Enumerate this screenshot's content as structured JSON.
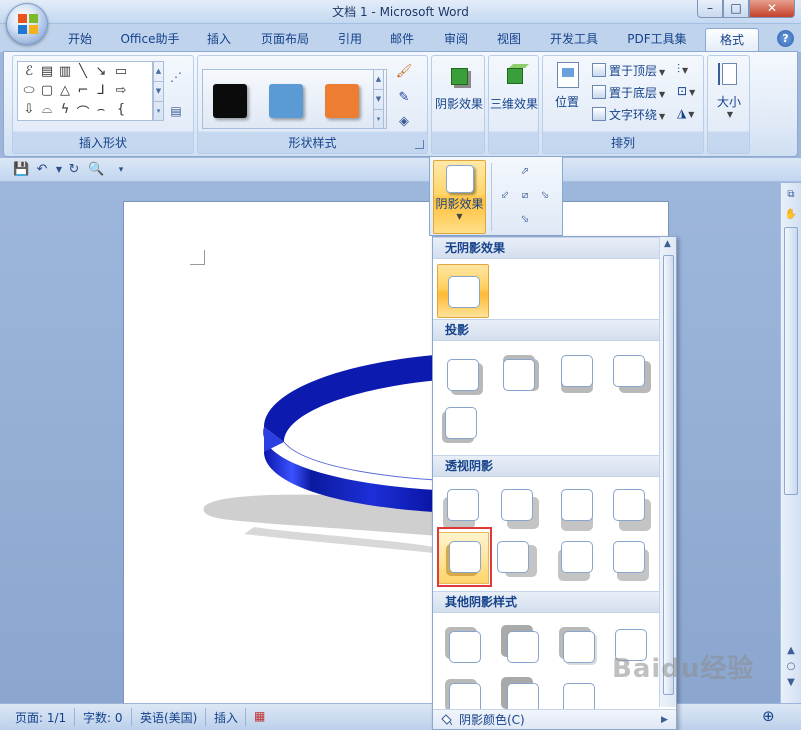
{
  "window": {
    "title": "文档 1 - Microsoft Word"
  },
  "tabs": [
    "开始",
    "Office助手",
    "插入",
    "页面布局",
    "引用",
    "邮件",
    "审阅",
    "视图",
    "开发工具",
    "PDF工具集",
    "格式"
  ],
  "active_tab": "格式",
  "ribbon": {
    "groups": {
      "insert_shapes": "插入形状",
      "shape_styles": "形状样式",
      "arrange": "排列"
    },
    "shape_style_swatches": [
      "#0b0b0b",
      "#5b9bd5",
      "#ed7d31"
    ],
    "buttons": {
      "shadow_effects": "阴影效果",
      "3d_effects": "三维效果",
      "position": "位置",
      "bring_to_front": "置于顶层",
      "send_to_back": "置于底层",
      "text_wrapping": "文字环绕",
      "size": "大小"
    }
  },
  "shadow_popup": {
    "button_label": "阴影效果",
    "sections": {
      "none": "无阴影效果",
      "drop": "投影",
      "perspective": "透视阴影",
      "other": "其他阴影样式"
    },
    "footer": "阴影颜色(C)"
  },
  "status_bar": {
    "page": "页面: 1/1",
    "words": "字数: 0",
    "language": "英语(美国)",
    "mode": "插入"
  },
  "watermark": "Baidu经验",
  "colors": {
    "accent": "#15428b",
    "selection": "#ffcf5e",
    "annotation_box": "#e0393c",
    "ring": "#1b2fc8"
  }
}
